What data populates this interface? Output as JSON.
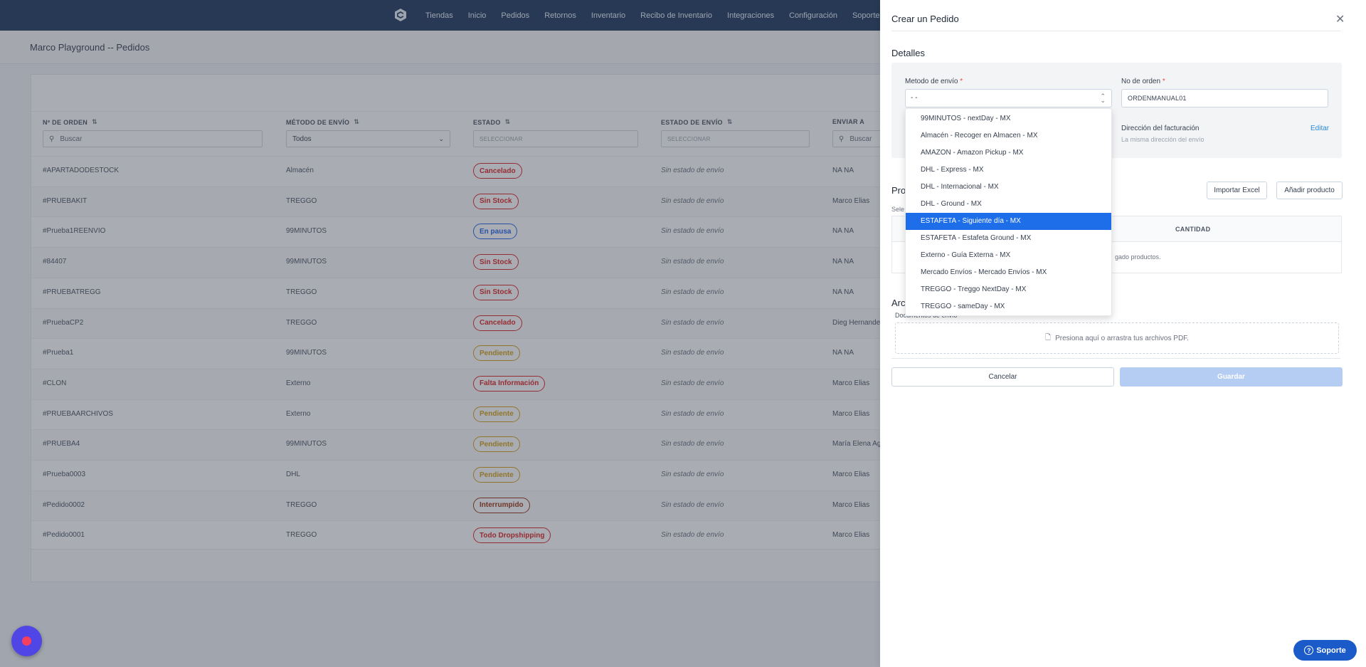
{
  "nav": {
    "items": [
      "Tiendas",
      "Inicio",
      "Pedidos",
      "Retornos",
      "Inventario",
      "Recibo de Inventario",
      "Integraciones",
      "Configuración",
      "Soporte"
    ]
  },
  "page": {
    "title": "Marco Playground -- Pedidos"
  },
  "table": {
    "headers": {
      "order": "Nº DE ORDEN",
      "method": "MÉTODO DE ENVÍO",
      "status": "ESTADO",
      "ship_status": "ESTADO DE ENVÍO",
      "ship_to": "ENVIAR A"
    },
    "filters": {
      "order_placeholder": "Buscar",
      "method_value": "Todos",
      "status_placeholder": "SELECCIONAR",
      "ship_status_placeholder": "SELECCIONAR",
      "ship_to_placeholder": "Buscar"
    },
    "rows": [
      {
        "order": "#APARTADODESTOCK",
        "method": "Almacén",
        "status": "Cancelado",
        "ship_status": "Sin estado de envío",
        "ship_to": "NA NA"
      },
      {
        "order": "#PRUEBAKIT",
        "method": "TREGGO",
        "status": "Sin Stock",
        "ship_status": "Sin estado de envío",
        "ship_to": "Marco Elias"
      },
      {
        "order": "#Prueba1REENVIO",
        "method": "99MINUTOS",
        "status": "En pausa",
        "ship_status": "Sin estado de envío",
        "ship_to": "NA NA"
      },
      {
        "order": "#84407",
        "method": "99MINUTOS",
        "status": "Sin Stock",
        "ship_status": "Sin estado de envío",
        "ship_to": "NA NA"
      },
      {
        "order": "#PRUEBATREGG",
        "method": "TREGGO",
        "status": "Sin Stock",
        "ship_status": "Sin estado de envío",
        "ship_to": "NA NA"
      },
      {
        "order": "#PruebaCP2",
        "method": "TREGGO",
        "status": "Cancelado",
        "ship_status": "Sin estado de envío",
        "ship_to": "Dieg Hernandez"
      },
      {
        "order": "#Prueba1",
        "method": "99MINUTOS",
        "status": "Pendiente",
        "ship_status": "Sin estado de envío",
        "ship_to": "NA NA"
      },
      {
        "order": "#CLON",
        "method": "Externo",
        "status": "Falta Información",
        "ship_status": "Sin estado de envío",
        "ship_to": "Marco Elias"
      },
      {
        "order": "#PRUEBAARCHIVOS",
        "method": "Externo",
        "status": "Pendiente",
        "ship_status": "Sin estado de envío",
        "ship_to": "Marco Elias"
      },
      {
        "order": "#PRUEBA4",
        "method": "99MINUTOS",
        "status": "Pendiente",
        "ship_status": "Sin estado de envío",
        "ship_to": "María Elena Agu"
      },
      {
        "order": "#Prueba0003",
        "method": "DHL",
        "status": "Pendiente",
        "ship_status": "Sin estado de envío",
        "ship_to": "Marco Elias"
      },
      {
        "order": "#Pedido0002",
        "method": "TREGGO",
        "status": "Interrumpido",
        "ship_status": "Sin estado de envío",
        "ship_to": "Marco Elias"
      },
      {
        "order": "#Pedido0001",
        "method": "TREGGO",
        "status": "Todo Dropshipping",
        "ship_status": "Sin estado de envío",
        "ship_to": "Marco Elias"
      }
    ]
  },
  "status_colors": {
    "Cancelado": "#dc2626",
    "Sin Stock": "#dc2626",
    "En pausa": "#2563eb",
    "Pendiente": "#d4a017",
    "Falta Información": "#dc2626",
    "Interrumpido": "#9a3412",
    "Todo Dropshipping": "#dc2626"
  },
  "panel": {
    "title": "Crear un Pedido",
    "details_title": "Detalles",
    "shipping_label": "Metodo de envío",
    "shipping_value": "- -",
    "order_label": "No de orden",
    "order_value": "ORDENMANUAL01",
    "billing_title": "Dirección del facturación",
    "billing_sub": "La misma dirección del envío",
    "edit": "Editar",
    "products_title": "Pro",
    "products_sub": "Sele",
    "import_excel": "Importar Excel",
    "add_product": "Añadir producto",
    "qty_header": "CANTIDAD",
    "empty_products": "gado productos.",
    "archives_title": "Arc",
    "docs_label": "Documentos de envío",
    "dropzone_text": "Presiona aquí o arrastra tus archivos PDF.",
    "cancel": "Cancelar",
    "save": "Guardar",
    "dropdown_options": [
      "99MINUTOS - nextDay - MX",
      "Almacén - Recoger en Almacen - MX",
      "AMAZON - Amazon Pickup - MX",
      "DHL - Express - MX",
      "DHL - Internacional - MX",
      "DHL - Ground - MX",
      "ESTAFETA - Siguiente día - MX",
      "ESTAFETA - Estafeta Ground - MX",
      "Externo - Guía Externa - MX",
      "Mercado Envíos - Mercado Envíos - MX",
      "TREGGO - Treggo NextDay - MX",
      "TREGGO - sameDay - MX"
    ],
    "dropdown_active": "ESTAFETA - Siguiente día - MX"
  },
  "support": {
    "label": "Soporte"
  }
}
